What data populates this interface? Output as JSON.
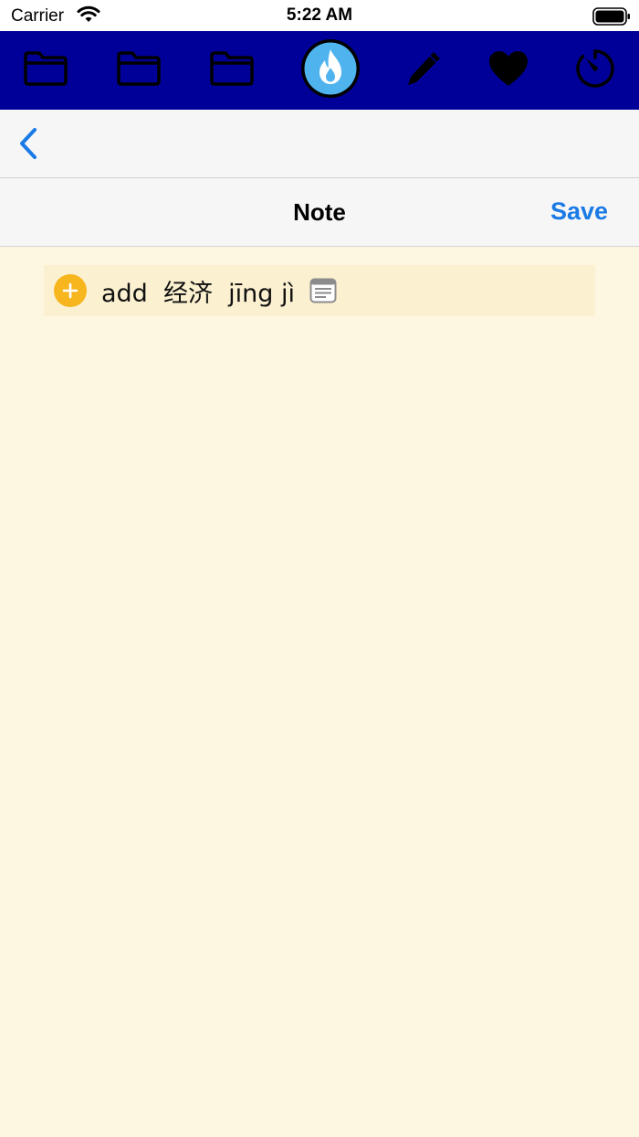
{
  "status_bar": {
    "carrier": "Carrier",
    "time": "5:22 AM"
  },
  "toolbar": {
    "items": [
      {
        "icon": "folder-icon"
      },
      {
        "icon": "folder-icon"
      },
      {
        "icon": "folder-icon"
      },
      {
        "icon": "flame-icon",
        "active": true
      },
      {
        "icon": "pencil-icon"
      },
      {
        "icon": "heart-icon"
      },
      {
        "icon": "timer-icon"
      }
    ]
  },
  "nav": {
    "back_icon": "chevron-left-icon"
  },
  "header": {
    "title": "Note",
    "save_label": "Save"
  },
  "word_row": {
    "action": "add",
    "hanzi": "经济",
    "pinyin": "jīng jì",
    "text": "add  经济  jīng jì"
  },
  "colors": {
    "toolbar_bg": "#000099",
    "accent_blue": "#1a7ae6",
    "add_orange": "#f7b51e",
    "page_bg": "#fdf6e0",
    "row_bg": "#fbf0d0"
  }
}
